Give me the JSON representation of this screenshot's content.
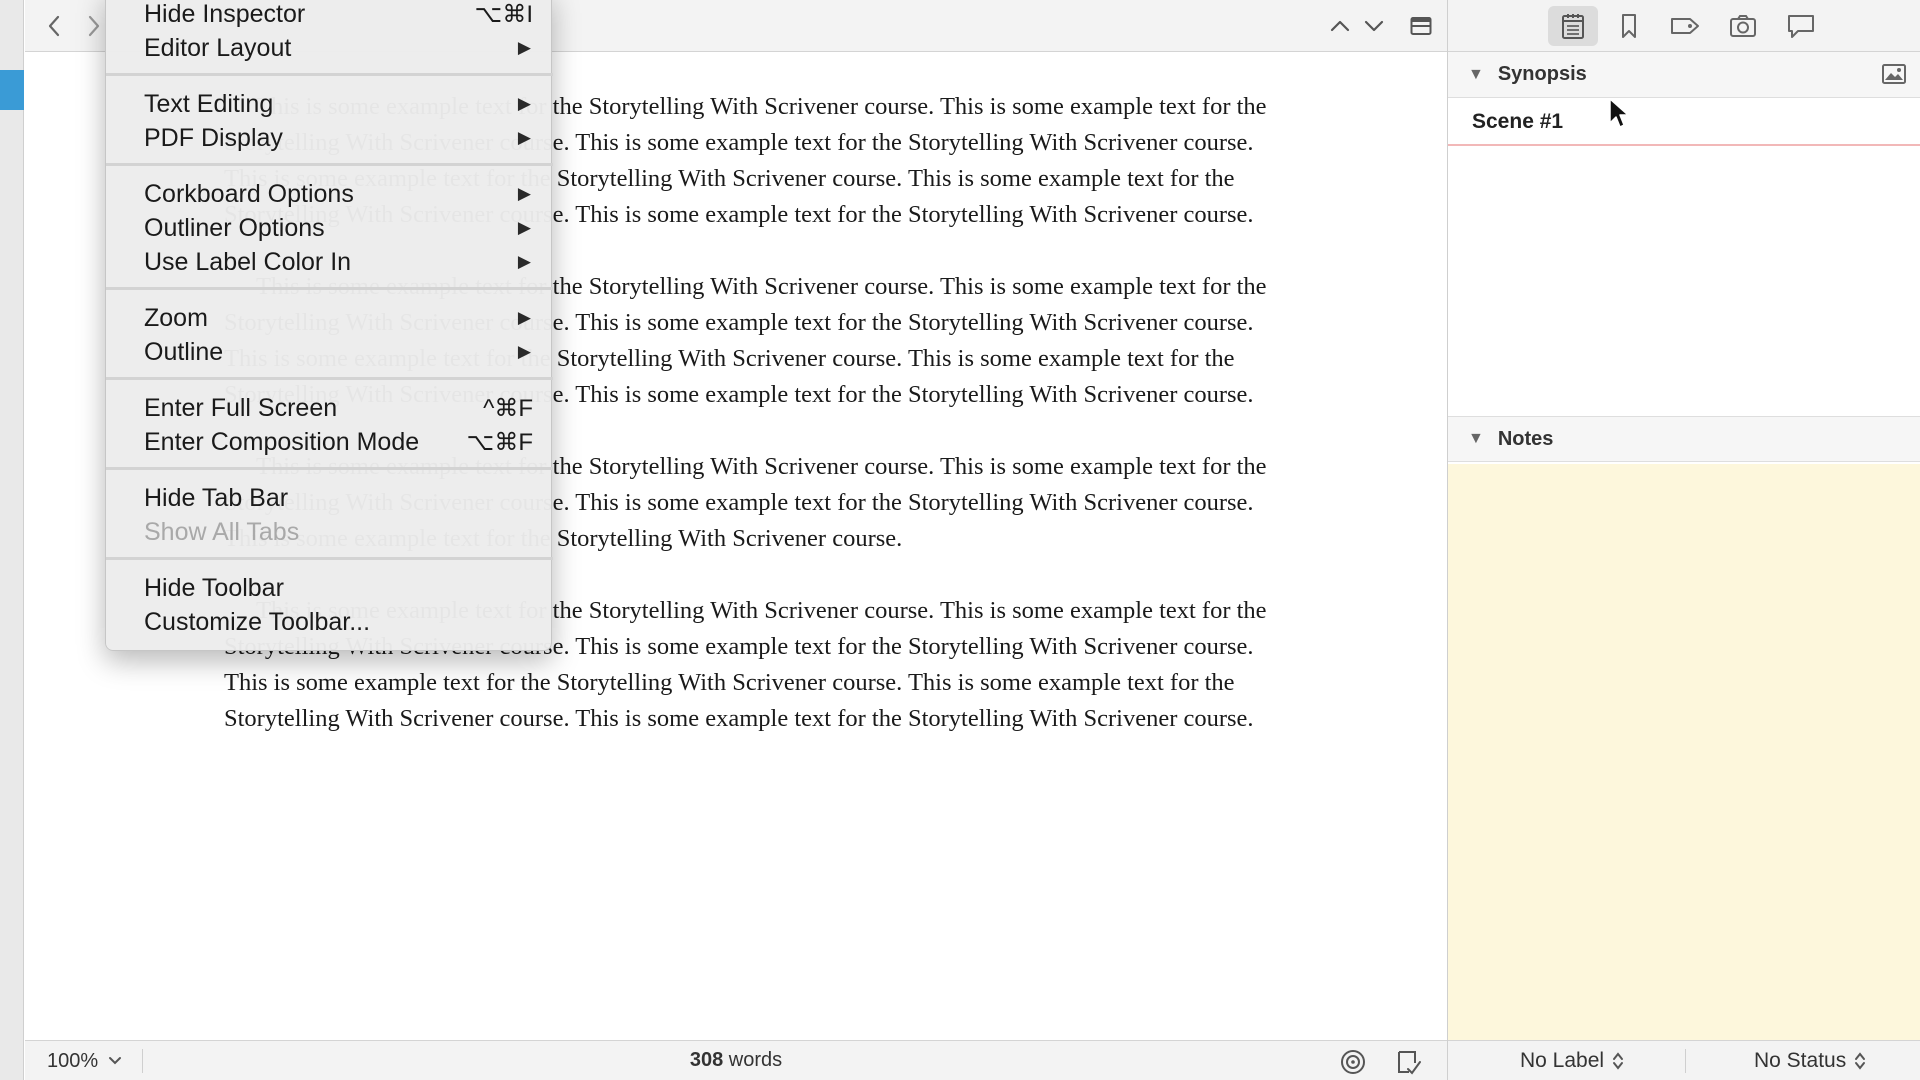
{
  "editor": {
    "paragraphs": [
      "This is some example text for the Storytelling With Scrivener course. This is some example text for the Storytelling With Scrivener course. This is some example text for the Storytelling With Scrivener course. This is some example text for the Storytelling With Scrivener course. This is some example text for the Storytelling With Scrivener course. This is some example text for the Storytelling With Scrivener course.",
      "This is some example text for the Storytelling With Scrivener course. This is some example text for the Storytelling With Scrivener course. This is some example text for the Storytelling With Scrivener course. This is some example text for the Storytelling With Scrivener course. This is some example text for the Storytelling With Scrivener course. This is some example text for the Storytelling With Scrivener course.",
      "This is some example text for the Storytelling With Scrivener course. This is some example text for the Storytelling With Scrivener course. This is some example text for the Storytelling With Scrivener course. This is some example text for the Storytelling With Scrivener course.",
      "This is some example text for the Storytelling With Scrivener course. This is some example text for the Storytelling With Scrivener course. This is some example text for the Storytelling With Scrivener course. This is some example text for the Storytelling With Scrivener course. This is some example text for the Storytelling With Scrivener course. This is some example text for the Storytelling With Scrivener course."
    ],
    "footer": {
      "zoom": "100%",
      "word_count": "308",
      "word_label": "words"
    }
  },
  "inspector": {
    "synopsis_header": "Synopsis",
    "synopsis_title": "Scene #1",
    "notes_header": "Notes",
    "label_select": "No Label",
    "status_select": "No Status"
  },
  "menu": {
    "items": [
      {
        "label": "Hide Inspector",
        "shortcut": "⌥⌘I"
      },
      {
        "label": "Editor Layout",
        "submenu": true
      },
      {
        "label": "Text Editing",
        "submenu": true
      },
      {
        "label": "PDF Display",
        "submenu": true
      },
      {
        "label": "Corkboard Options",
        "submenu": true
      },
      {
        "label": "Outliner Options",
        "submenu": true
      },
      {
        "label": "Use Label Color In",
        "submenu": true
      },
      {
        "label": "Zoom",
        "submenu": true
      },
      {
        "label": "Outline",
        "submenu": true
      },
      {
        "label": "Enter Full Screen",
        "shortcut": "^⌘F"
      },
      {
        "label": "Enter Composition Mode",
        "shortcut": "⌥⌘F"
      },
      {
        "label": "Hide Tab Bar"
      },
      {
        "label": "Show All Tabs",
        "disabled": true
      },
      {
        "label": "Hide Toolbar"
      },
      {
        "label": "Customize Toolbar..."
      }
    ],
    "submenu_arrow": "▶"
  },
  "colors": {
    "notes_background": "#fdf7dc",
    "binder_selection": "#3a9bd6",
    "synopsis_underline": "#f2b8b8"
  },
  "icons": [
    "back-arrow-icon",
    "forward-arrow-icon",
    "chevron-up-icon",
    "chevron-down-icon",
    "split-editor-icon",
    "notes-inspector-icon",
    "bookmark-icon",
    "metadata-tag-icon",
    "snapshot-camera-icon",
    "comments-icon",
    "synopsis-image-icon",
    "target-icon",
    "compile-notes-icon",
    "mouse-cursor-icon"
  ]
}
